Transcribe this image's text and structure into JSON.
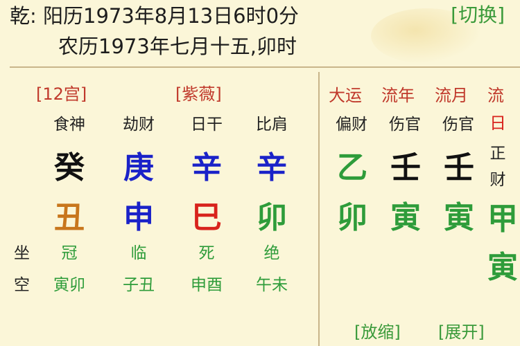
{
  "header": {
    "line1": "乾: 阳历1973年8月13日6时0分",
    "line2": "农历1973年七月十五,卯时",
    "switch_label": "[切换]"
  },
  "left_panel": {
    "label_12gong": "[12宫]",
    "label_ziwei": "[紫薇]",
    "columns": [
      {
        "shishen": "食神",
        "tiangan": "癸",
        "tiangan_color": "#111111",
        "dizhi": "丑",
        "dizhi_color": "#c8761c",
        "zuo": "冠",
        "kong": "寅卯"
      },
      {
        "shishen": "劫财",
        "tiangan": "庚",
        "tiangan_color": "#1a22c8",
        "dizhi": "申",
        "dizhi_color": "#1a22c8",
        "zuo": "临",
        "kong": "子丑"
      },
      {
        "shishen": "日干",
        "tiangan": "辛",
        "tiangan_color": "#1a22c8",
        "dizhi": "巳",
        "dizhi_color": "#d8231c",
        "zuo": "死",
        "kong": "申酉"
      },
      {
        "shishen": "比肩",
        "tiangan": "辛",
        "tiangan_color": "#1a22c8",
        "dizhi": "卯",
        "dizhi_color": "#2e9c3a",
        "zuo": "绝",
        "kong": "午未"
      }
    ],
    "row_zuo": "坐",
    "row_kong": "空"
  },
  "right_panel": {
    "heads": [
      "大运",
      "流年",
      "流月",
      "流"
    ],
    "columns": [
      {
        "shishen": "偏财",
        "tiangan": "乙",
        "tiangan_color": "#2e9c3a",
        "dizhi": "卯",
        "dizhi_color": "#2e9c3a"
      },
      {
        "shishen": "伤官",
        "tiangan": "壬",
        "tiangan_color": "#111111",
        "dizhi": "寅",
        "dizhi_color": "#2e9c3a"
      },
      {
        "shishen": "伤官",
        "tiangan": "壬",
        "tiangan_color": "#111111",
        "dizhi": "寅",
        "dizhi_color": "#2e9c3a"
      },
      {
        "shishen_line1": "日",
        "shishen_line2": "正",
        "shishen_line3": "财",
        "tiangan": "甲",
        "tiangan_color": "#2e9c3a",
        "dizhi": "寅",
        "dizhi_color": "#2e9c3a"
      }
    ],
    "fangsuo_label": "[放缩]",
    "zhankai_label": "[展开]"
  },
  "colors": {
    "background": "#fbf6d8",
    "accent_red": "#c0392b",
    "accent_green": "#3a9a3a",
    "zuo_kong_green": "#2e9c3a"
  }
}
